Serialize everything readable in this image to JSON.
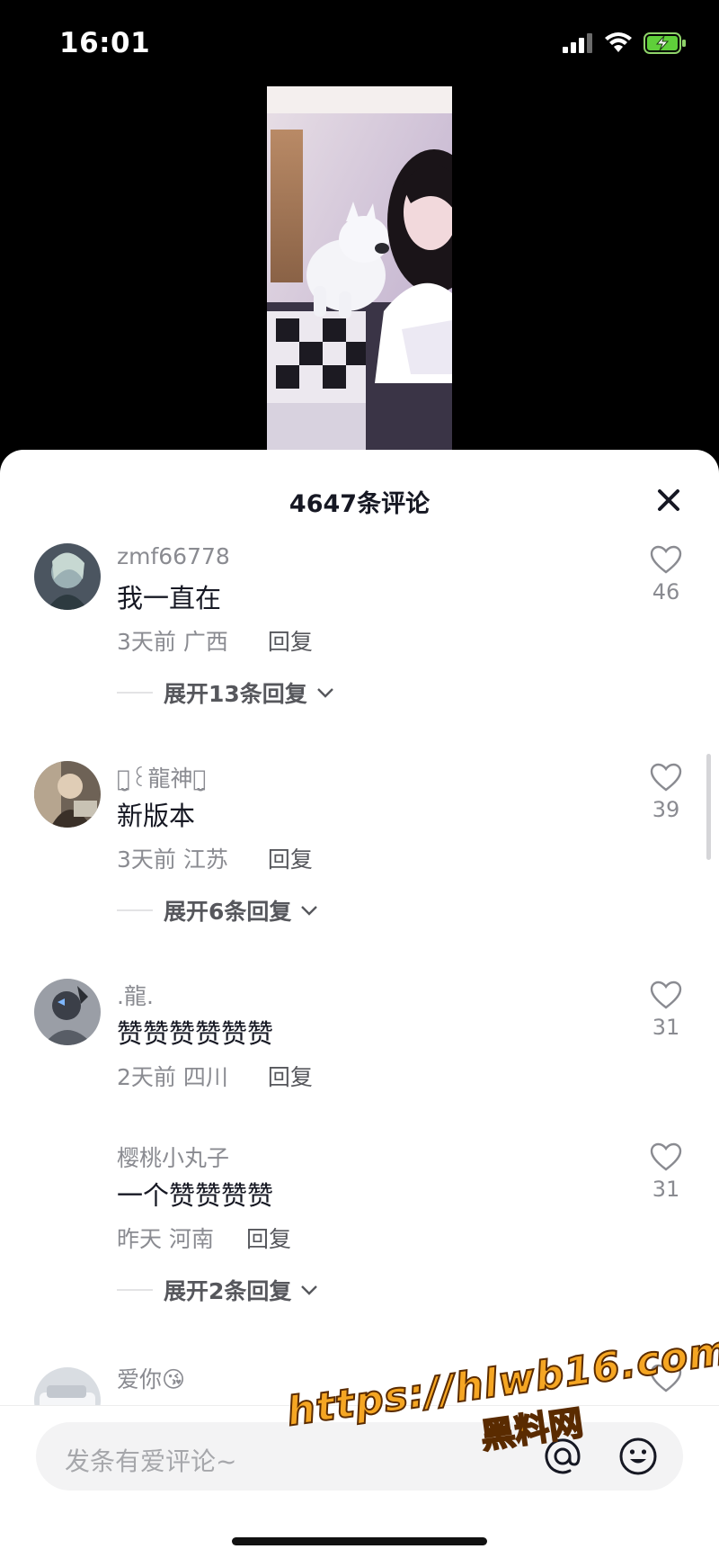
{
  "status_bar": {
    "time": "16:01"
  },
  "sheet": {
    "title": "4647条评论",
    "close_icon": "close-icon"
  },
  "comments": [
    {
      "user": "zmf66778",
      "text": "我一直在",
      "time": "3天前",
      "location": "广西",
      "reply": "回复",
      "likes": "46",
      "expand": "展开13条回复"
    },
    {
      "user": "ꪔ̤̮꒰龍神ꪔ̤̮",
      "text": "新版本",
      "time": "3天前",
      "location": "江苏",
      "reply": "回复",
      "likes": "39",
      "expand": "展开6条回复"
    },
    {
      "user": ".龍.",
      "text": "赞赞赞赞赞赞",
      "time": "2天前",
      "location": "四川",
      "reply": "回复",
      "likes": "31"
    },
    {
      "user": "樱桃小丸子",
      "text": "一个赞赞赞赞",
      "time": "昨天",
      "location": "河南",
      "reply": "回复",
      "likes": "31",
      "expand": "展开2条回复"
    },
    {
      "user": "爱你😘"
    }
  ],
  "input": {
    "placeholder": "发条有爱评论~"
  },
  "watermark": {
    "url": "https://hlwb16.com",
    "name": "黑料网"
  },
  "colors": {
    "accent_watermark": "#f5a623",
    "text_primary": "#161823",
    "text_secondary": "#8a8b91"
  }
}
